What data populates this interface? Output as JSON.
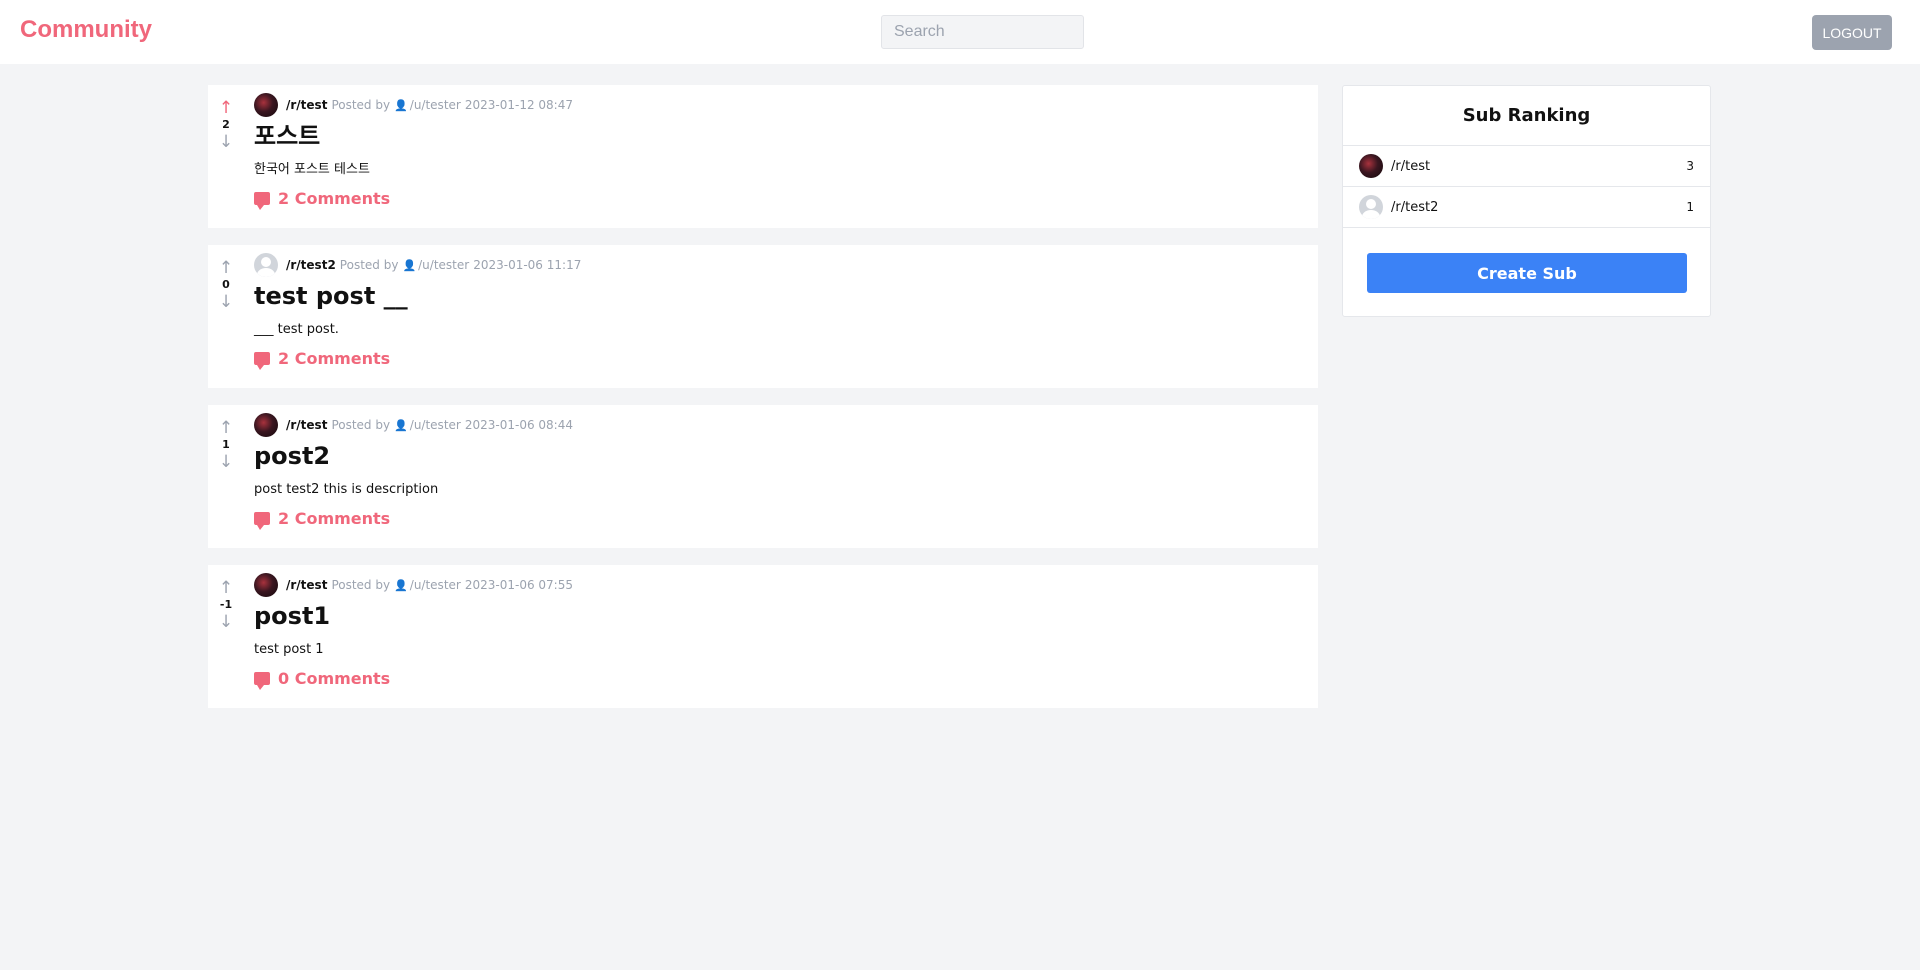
{
  "header": {
    "brand": "Community",
    "search_placeholder": "Search",
    "logout_label": "LOGOUT"
  },
  "posts": [
    {
      "score": "2",
      "upvoted": true,
      "sub": "/r/test",
      "sub_avatar": "dark",
      "posted_by": "Posted by",
      "user": "/u/tester",
      "date": "2023-01-12 08:47",
      "title": "포스트",
      "description": "한국어 포스트 테스트",
      "comments": "2 Comments"
    },
    {
      "score": "0",
      "upvoted": false,
      "sub": "/r/test2",
      "sub_avatar": "gray",
      "posted_by": "Posted by",
      "user": "/u/tester",
      "date": "2023-01-06 11:17",
      "title": "test post __",
      "description": "___ test post.",
      "comments": "2 Comments"
    },
    {
      "score": "1",
      "upvoted": false,
      "sub": "/r/test",
      "sub_avatar": "dark",
      "posted_by": "Posted by",
      "user": "/u/tester",
      "date": "2023-01-06 08:44",
      "title": "post2",
      "description": "post test2 this is description",
      "comments": "2 Comments"
    },
    {
      "score": "-1",
      "upvoted": false,
      "sub": "/r/test",
      "sub_avatar": "dark",
      "posted_by": "Posted by",
      "user": "/u/tester",
      "date": "2023-01-06 07:55",
      "title": "post1",
      "description": "test post 1",
      "comments": "0 Comments"
    }
  ],
  "sidebar": {
    "title": "Sub Ranking",
    "items": [
      {
        "name": "/r/test",
        "count": "3",
        "avatar": "dark"
      },
      {
        "name": "/r/test2",
        "count": "1",
        "avatar": "gray"
      }
    ],
    "create_label": "Create Sub"
  },
  "icons": {
    "upvote": "arrow-up-icon",
    "downvote": "arrow-down-icon",
    "user": "user-icon",
    "comment": "comment-icon"
  },
  "colors": {
    "brand": "#f0677b",
    "primary_button": "#3b82f6",
    "logout_button": "#9ca3af"
  }
}
